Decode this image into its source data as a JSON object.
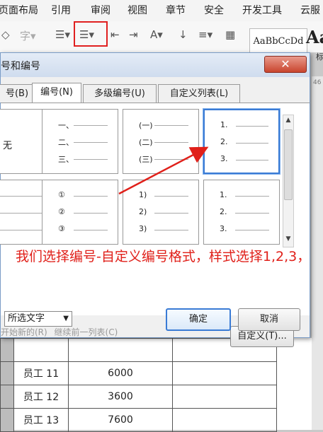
{
  "ribbon": {
    "tabs": [
      "页面布局",
      "引用",
      "审阅",
      "视图",
      "章节",
      "安全",
      "开发工具",
      "云服"
    ],
    "style_preview": "AaBbCcDd",
    "style_big": "Aa",
    "style_sub": "标"
  },
  "ruler": {
    "mark": "46"
  },
  "dialog": {
    "title": "号和编号",
    "close_label": "✕",
    "tabs": [
      "号(B)",
      "编号(N)",
      "多级编号(U)",
      "自定义列表(L)"
    ],
    "active_tab": "编号(N)",
    "gallery": {
      "none_label": "无",
      "cells": [
        {
          "items": [
            "一、",
            "二、",
            "三、"
          ]
        },
        {
          "items": [
            "(一)",
            "(二)",
            "(三)"
          ]
        },
        {
          "items": [
            "1.",
            "2.",
            "3."
          ],
          "selected": true
        },
        {
          "items": [
            "①",
            "②",
            "③"
          ]
        },
        {
          "items": [
            "1)",
            "2)",
            "3)"
          ]
        },
        {
          "items": [
            "1.",
            "2.",
            "3."
          ]
        }
      ]
    },
    "restart_label": "开始新的(R)",
    "continue_label": "继续前一列表(C)",
    "custom_button": "自定义(T)...",
    "apply_to": "所选文字",
    "ok": "确定",
    "cancel": "取消"
  },
  "annotation": "我们选择编号-自定义编号格式，样式选择1,2,3，",
  "table": {
    "rows": [
      {
        "name": "",
        "value": ""
      },
      {
        "name": "员工 11",
        "value": "6000"
      },
      {
        "name": "员工 12",
        "value": "3600"
      },
      {
        "name": "员工 13",
        "value": "7600"
      }
    ]
  },
  "colors": {
    "highlight": "#e02020",
    "annotation": "#e0201a",
    "selection": "#3a7bd5"
  }
}
